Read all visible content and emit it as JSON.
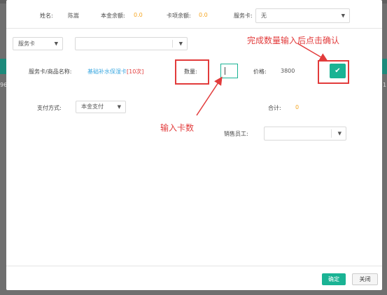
{
  "background": {
    "left_numbers": "96",
    "right_numbers": "1"
  },
  "customer": {
    "name_label": "姓名:",
    "name_value": "陈嵩",
    "principal_label": "本金余额:",
    "principal_value": "0.0",
    "card_balance_label": "卡项余额:",
    "card_balance_value": "0.0",
    "service_card_label": "服务卡:",
    "service_card_value": "无"
  },
  "filter": {
    "category_value": "服务卡",
    "product_value": ""
  },
  "item": {
    "name_label": "服务卡/商品名称:",
    "name_value": "基础补水保湿卡",
    "name_count": "[10次]",
    "qty_label": "数量:",
    "price_label": "价格:",
    "price_value": "3800"
  },
  "payment": {
    "method_label": "支付方式:",
    "method_value": "本金支付",
    "total_label": "合计:",
    "total_value": "0",
    "staff_label": "销售员工:",
    "staff_value": ""
  },
  "annotations": {
    "confirm_note": "完成数量输入后点击确认",
    "qty_note": "输入卡数"
  },
  "footer": {
    "ok_label": "确定",
    "close_label": "关闭"
  },
  "colors": {
    "accent": "#1ab394",
    "money": "#f5a623",
    "annotation": "#e23b3b",
    "link": "#3aa7e0"
  }
}
